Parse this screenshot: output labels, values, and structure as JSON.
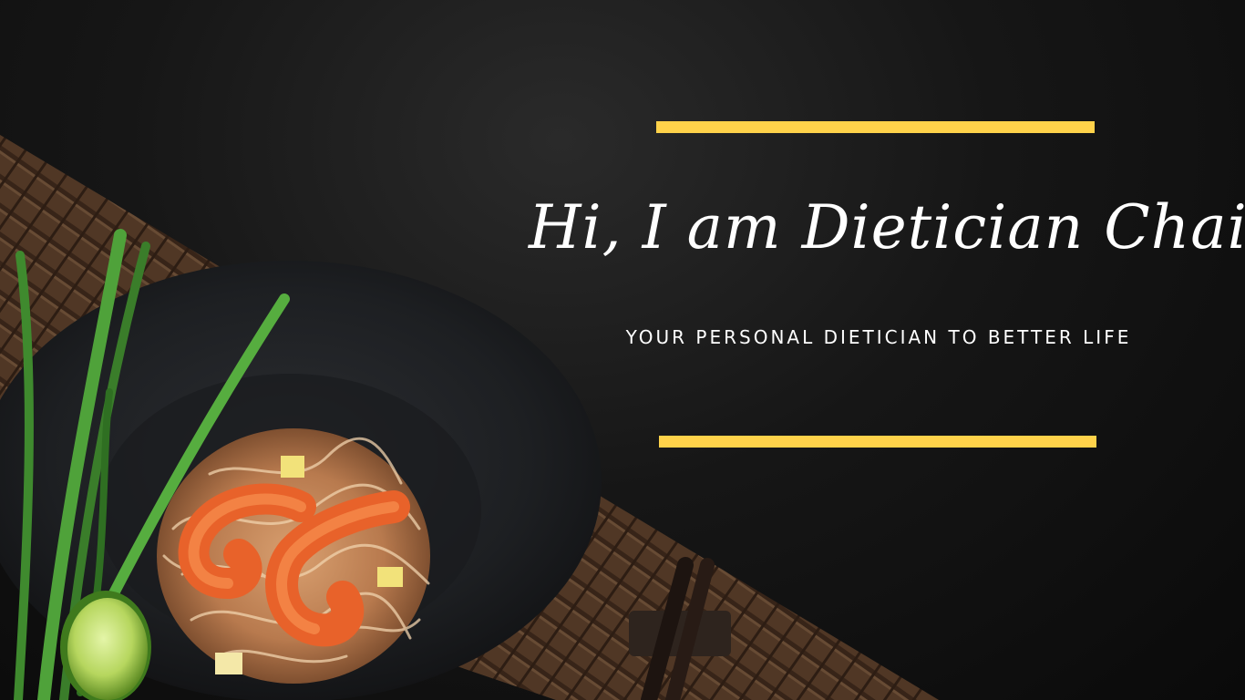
{
  "hero": {
    "headline": "Hi, I am Dietician Chaitra",
    "tagline": "YOUR PERSONAL DIETICIAN TO BETTER LIFE",
    "accent_color": "#ffd24a",
    "background_color": "#111111"
  },
  "photo": {
    "items": [
      "bamboo-placemat",
      "black-plate",
      "pad-thai-noodles",
      "shrimp",
      "spring-onion",
      "lime-wedge",
      "chopsticks"
    ]
  }
}
